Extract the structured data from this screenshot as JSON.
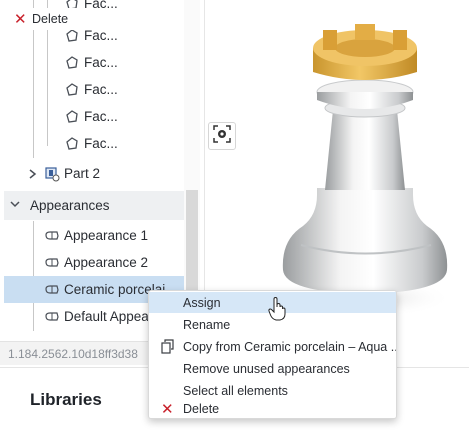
{
  "tree": {
    "top_delete_label": "Delete",
    "partial_top_label": "Fac...",
    "face_items": [
      "Fac...",
      "Fac...",
      "Fac...",
      "Fac...",
      "Fac..."
    ],
    "part2_label": "Part 2",
    "appearances_header": "Appearances",
    "appearance_items": [
      {
        "label": "Appearance 1"
      },
      {
        "label": "Appearance 2"
      },
      {
        "label": "Ceramic porcelai..."
      },
      {
        "label": "Default Appea..."
      }
    ]
  },
  "status_bar": {
    "text": "1.184.2562.10d18ff3d38"
  },
  "libraries": {
    "title": "Libraries"
  },
  "context_menu": {
    "items": [
      {
        "label": "Assign"
      },
      {
        "label": "Rename"
      },
      {
        "label": "Copy from Ceramic porcelain – Aqua ..."
      },
      {
        "label": "Remove unused appearances"
      },
      {
        "label": "Select all elements"
      },
      {
        "label": "Delete"
      }
    ]
  },
  "colors": {
    "accent_selected": "#c9def2",
    "menu_hover": "#d6e7f7",
    "delete_red": "#c8202a",
    "rook_top": "#e9b84a"
  },
  "icons": {
    "face": "face-icon",
    "part": "part-icon",
    "appearance": "appearance-icon",
    "copy": "copy-icon",
    "delete": "delete-x-icon",
    "view": "view-orientation-icon"
  }
}
